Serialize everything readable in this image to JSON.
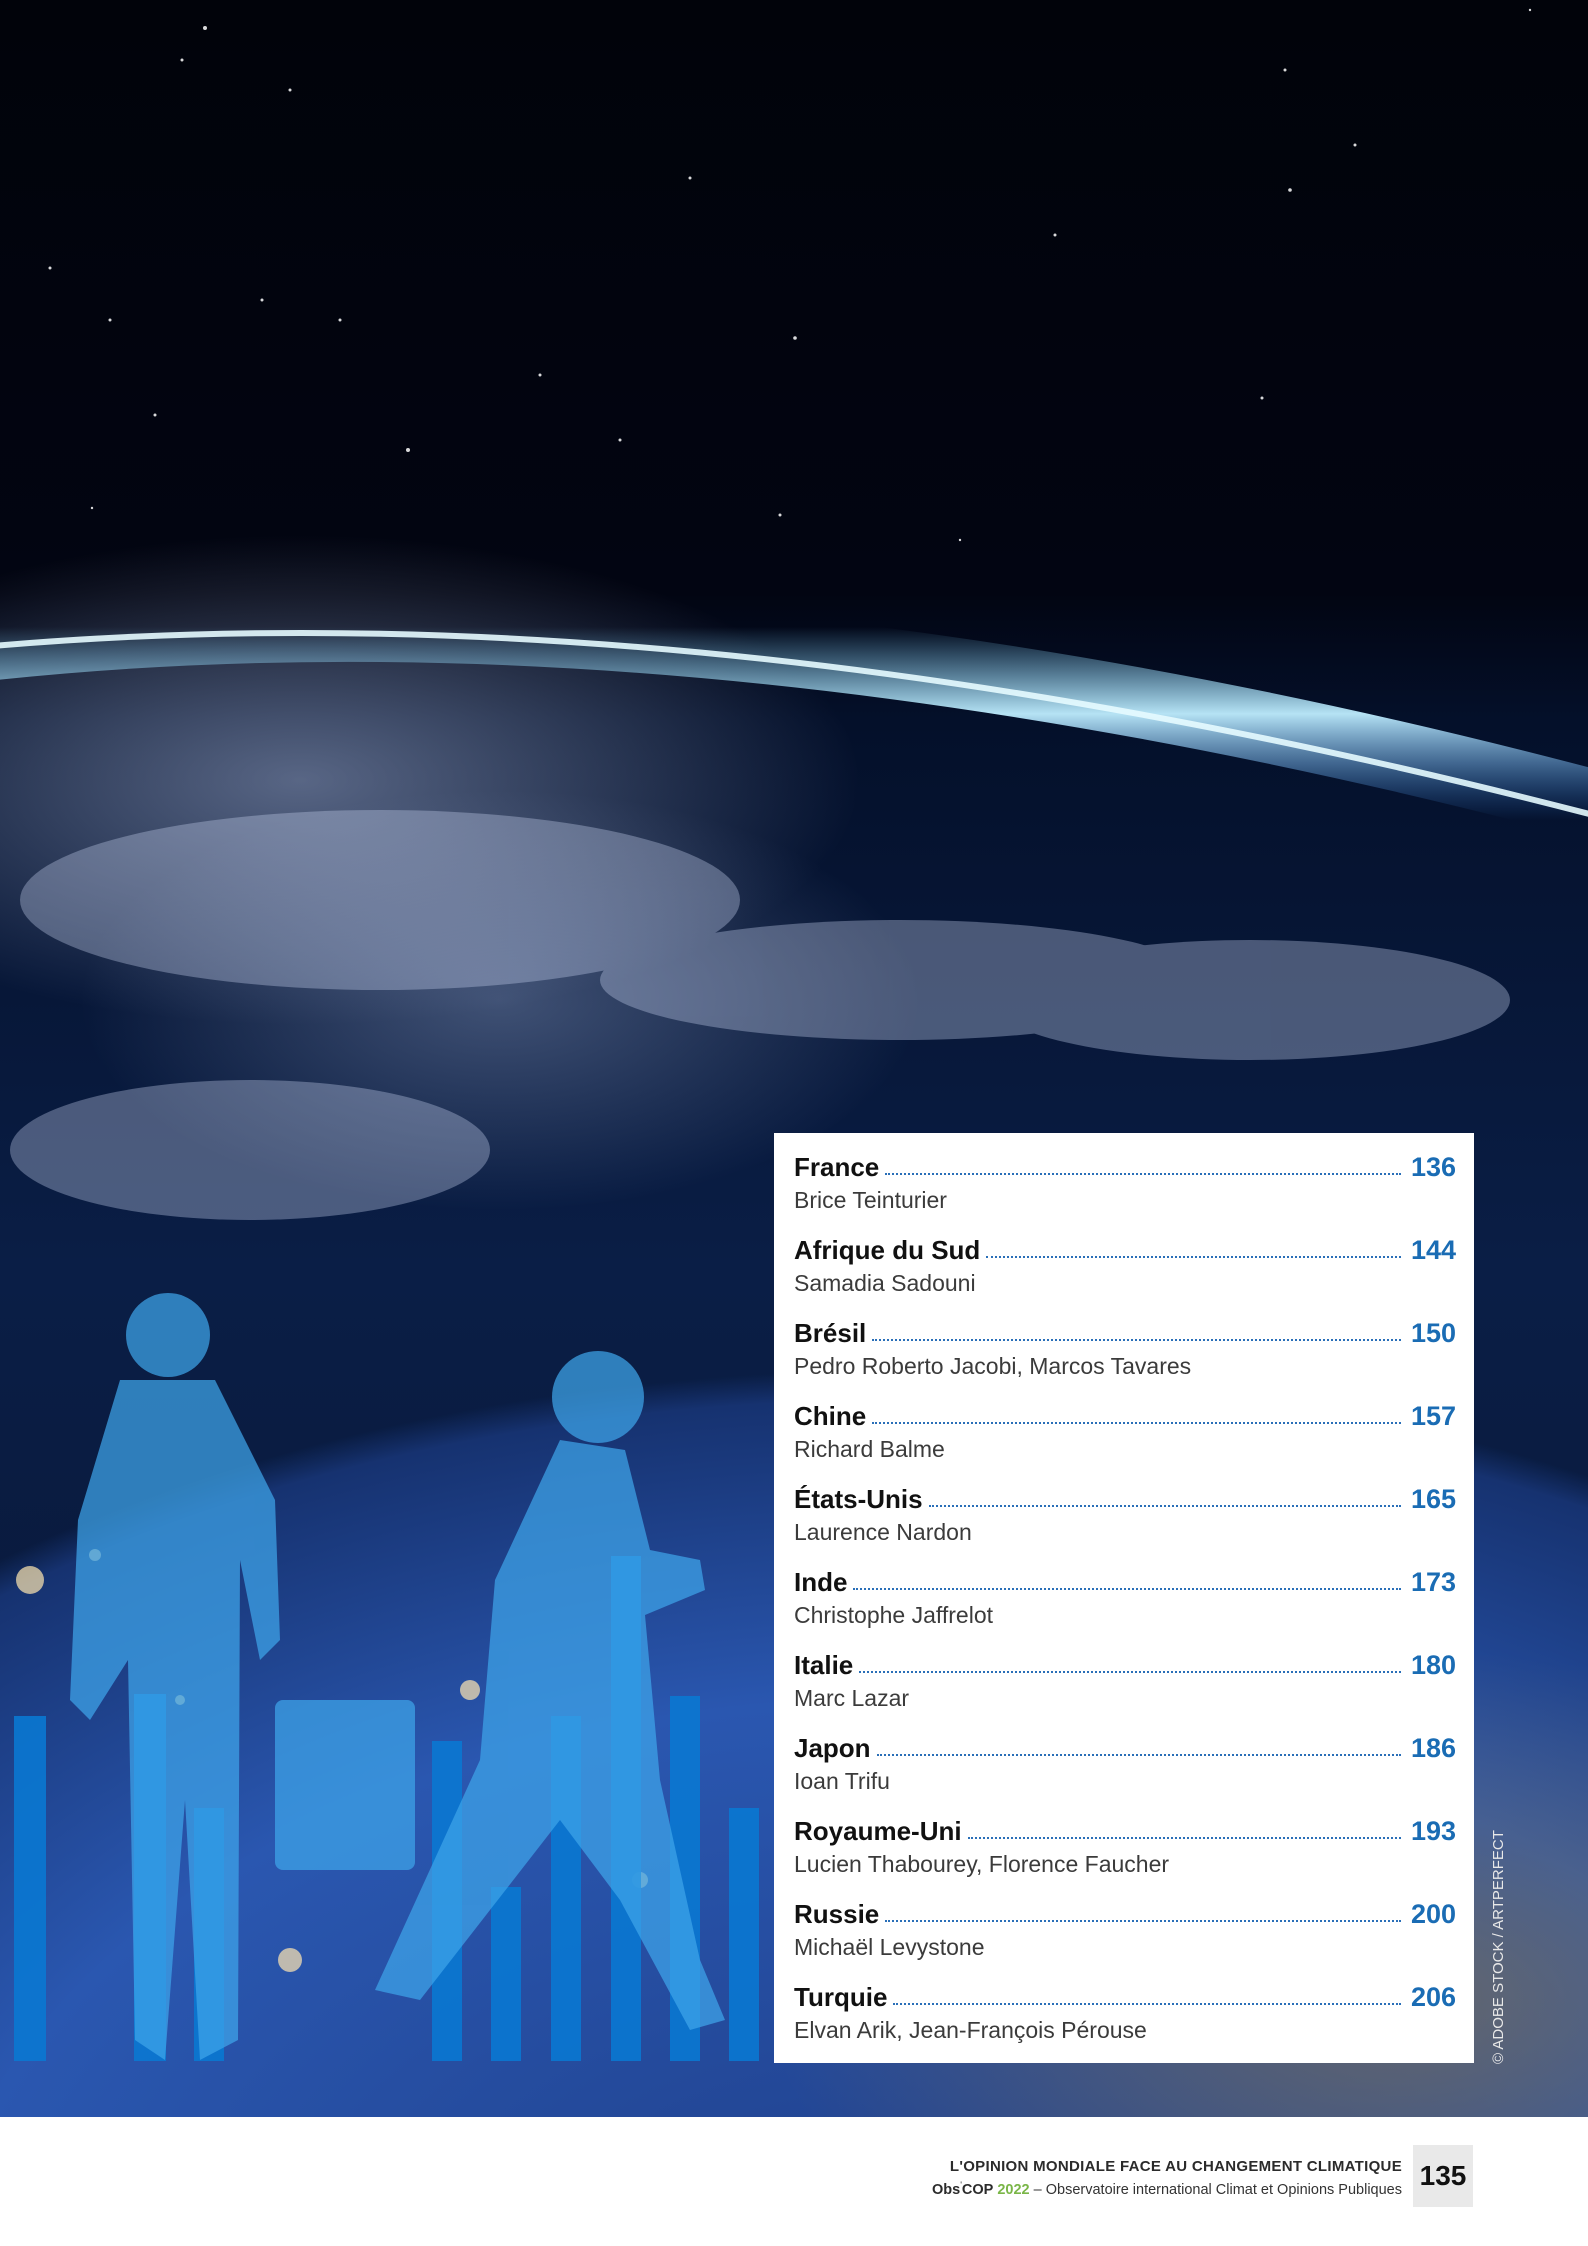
{
  "toc": [
    {
      "country": "France",
      "page": "136",
      "author": "Brice Teinturier"
    },
    {
      "country": "Afrique du Sud",
      "page": "144",
      "author": "Samadia Sadouni"
    },
    {
      "country": "Brésil",
      "page": "150",
      "author": "Pedro Roberto Jacobi, Marcos Tavares"
    },
    {
      "country": "Chine",
      "page": "157",
      "author": "Richard Balme"
    },
    {
      "country": "États-Unis",
      "page": "165",
      "author": "Laurence Nardon"
    },
    {
      "country": "Inde",
      "page": "173",
      "author": "Christophe Jaffrelot"
    },
    {
      "country": "Italie",
      "page": "180",
      "author": "Marc Lazar"
    },
    {
      "country": "Japon",
      "page": "186",
      "author": "Ioan Trifu"
    },
    {
      "country": "Royaume-Uni",
      "page": "193",
      "author": "Lucien Thabourey, Florence Faucher"
    },
    {
      "country": "Russie",
      "page": "200",
      "author": "Michaël Levystone"
    },
    {
      "country": "Turquie",
      "page": "206",
      "author": "Elvan Arik, Jean-François Pérouse"
    }
  ],
  "photo_credit": "© ADOBE STOCK / ARTPERFECT",
  "footer": {
    "title": "L'OPINION MONDIALE FACE AU CHANGEMENT CLIMATIQUE",
    "brand": "Obs",
    "brand_sup": "'",
    "brand_rest": "COP",
    "year": "2022",
    "subtitle": " – Observatoire international Climat et Opinions Publiques",
    "page_number": "135"
  },
  "colors": {
    "accent_blue": "#1a6cb4",
    "year_green": "#7ab648",
    "bar_blue": "#0a78d2"
  }
}
